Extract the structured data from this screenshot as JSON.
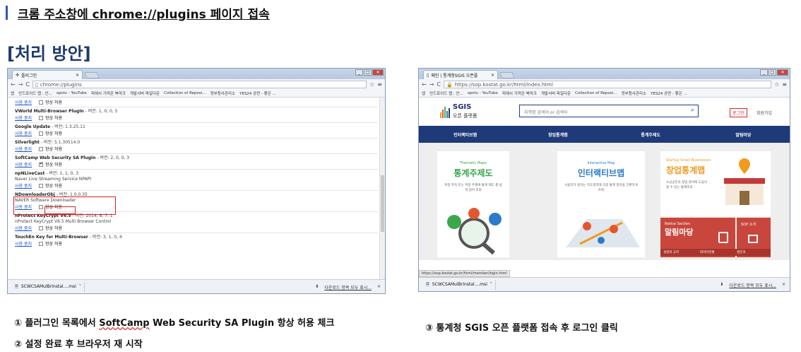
{
  "heading": {
    "text": "크롬 주소창에 chrome://plugins 페이지 접속"
  },
  "subheading": {
    "text": "[처리 방안]"
  },
  "left_browser": {
    "tab_title": "플러그인",
    "address": "chrome://plugins",
    "bookmarks": [
      "앱",
      "안드로이드 랩 : 안...",
      "spotv - YouTube",
      "피에서 가져온 북마크",
      "개발서버 파일다운",
      "Collection of Reposi...",
      "정부청사관리소",
      "YES24 공연 - 좋은 ..."
    ],
    "disable_label": "사용 중지",
    "always_allow_label": "항상 허용",
    "plugins": [
      {
        "name": "VWorld Multi-Browser PlugIn",
        "version": "- 버전: 1, 0, 0, 5",
        "desc": ""
      },
      {
        "name": "Google Update",
        "version": "- 버전: 1.3.25.11",
        "desc": ""
      },
      {
        "name": "Silverlight",
        "version": "- 버전: 5.1.30514.0",
        "desc": ""
      },
      {
        "name": "SoftCamp Web Security SA Plugin",
        "version": "- 버전: 2, 0, 0, 3",
        "desc": ""
      },
      {
        "name": "npNLiveCast",
        "version": "- 버전: 1, 1, 0, 3",
        "desc": "Naver Live Streaming Service NPAPI"
      },
      {
        "name": "NDownloaderObj",
        "version": "- 버전: 1.0.0.35",
        "desc": "NAVER Software Downloader"
      },
      {
        "name": "nProtect KeyCrypt V6.5",
        "version": "- 버전: 2014, 8, 7, 1",
        "desc": "nProtect KeyCrypt V6.5 Multi Browser Control"
      },
      {
        "name": "TouchEn Key for Multi-Browser",
        "version": "- 버전: 3, 1, 0, 4",
        "desc": ""
      }
    ],
    "download_file": "SCWCSAMulBrInstal....msi",
    "download_all": "다운로드 항목 모두 표시...",
    "close": "×"
  },
  "right_browser": {
    "tab_title": "메인 | 통계청SGIS 오픈플",
    "address": "https://sop.kostat.go.kr/html/index.html",
    "bookmarks": [
      "앱",
      "안드로이드 랩 : 안...",
      "spotv - YouTube",
      "피에서 가져온 북마크",
      "개발서버 파일다운",
      "Collection of Reposi...",
      "정부청사관리소",
      "YES24 공연 - 좋은 ..."
    ],
    "logo_main": "SGIS",
    "logo_sub": "오픈 플랫폼",
    "search_placeholder": "지역명 검색어 or 검색어",
    "login": "로그인",
    "join": "회원가입",
    "nav": [
      "인터랙티브맵",
      "창업통계맵",
      "통계주제도",
      "알림마당"
    ],
    "cards": [
      {
        "en": "Thematic Maps",
        "ko": "통계주제도",
        "desc": "특정 목적 또는 특정 주제에 통계 제도 를 쉽게 얻어 조회"
      },
      {
        "en": "Interactive Map",
        "ko": "인터랙티브맵",
        "desc": "사용자가 원하는 지도영역에 각종 통계 항목을 간편하게 조회"
      },
      {
        "en": "Startup Small Businesses",
        "ko": "창업통계맵",
        "desc": "소상공인의 창업 준비에 도움이 될 수 있는 통계조회"
      }
    ],
    "notice_en": "Notice Section",
    "notice_ko": "알림마당",
    "sop_label": "SOP 소개",
    "bottom_tabs": [
      "설명과 공지",
      "데이터현황",
      "질문과"
    ],
    "status_url": "https://sop.kostat.go.kr/html/member/login.html",
    "download_file": "SCWCSAMulBrInstal....msi",
    "download_all": "다운로드 항목 모두 표시...",
    "close": "×"
  },
  "captions": {
    "step1_prefix": "① 플러그인 목록에서 ",
    "step1_plugin": "SoftCamp",
    "step1_suffix": "  Web Security SA Plugin 항상 허용 체크",
    "step2": "② 설정 완료 후 브라우저 재 시작",
    "step3": "③ 통계청 SGIS 오픈 플랫폼 접속 후 로그인 클릭"
  },
  "colors": {
    "accent": "#1e3a78",
    "highlight": "#e02020",
    "link": "#1a55c7"
  }
}
